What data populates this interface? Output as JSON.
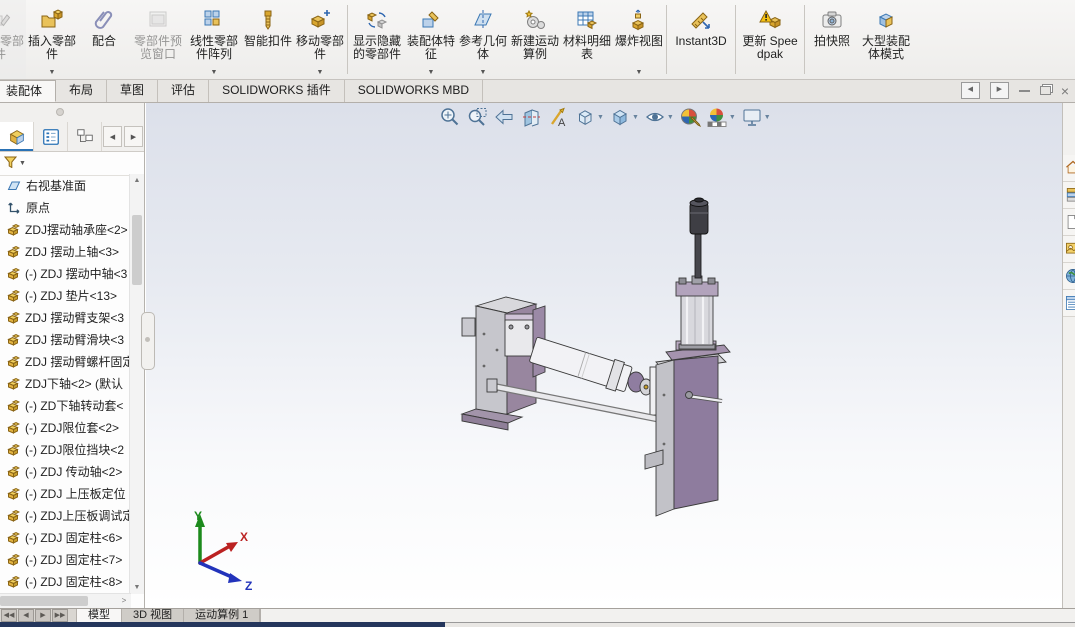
{
  "ribbon": {
    "items": [
      {
        "label": "编辑零部件",
        "icon": "edit-component",
        "disabled": true,
        "cut": true
      },
      {
        "label": "插入零部件",
        "icon": "insert-component",
        "dropdown": true
      },
      {
        "label": "配合",
        "icon": "mate"
      },
      {
        "label": "零部件预览窗口",
        "icon": "component-preview",
        "disabled": true
      },
      {
        "label": "线性零部件阵列",
        "icon": "linear-pattern",
        "dropdown": true
      },
      {
        "label": "智能扣件",
        "icon": "smart-fasteners"
      },
      {
        "label": "移动零部件",
        "icon": "move-component",
        "dropdown": true
      },
      {
        "sep": true
      },
      {
        "label": "显示隐藏的零部件",
        "icon": "show-hidden"
      },
      {
        "label": "装配体特征",
        "icon": "assembly-features",
        "dropdown": true
      },
      {
        "label": "参考几何体",
        "icon": "reference-geometry",
        "dropdown": true
      },
      {
        "label": "新建运动算例",
        "icon": "motion-study"
      },
      {
        "label": "材料明细表",
        "icon": "bom"
      },
      {
        "label": "爆炸视图",
        "icon": "exploded-view",
        "dropdown": true
      },
      {
        "sep": true
      },
      {
        "label": "Instant3D",
        "icon": "instant3d"
      },
      {
        "sep": true
      },
      {
        "label": "更新 Speedpak",
        "icon": "speedpak"
      },
      {
        "sep": true
      },
      {
        "label": "拍快照",
        "icon": "snapshot"
      },
      {
        "label": "大型装配体模式",
        "icon": "large-assembly"
      }
    ]
  },
  "tabs": {
    "active": 0,
    "items": [
      "装配体",
      "布局",
      "草图",
      "评估",
      "SOLIDWORKS 插件",
      "SOLIDWORKS MBD"
    ]
  },
  "window_controls": [
    "pane-left",
    "pane-right",
    "minimize",
    "restore",
    "close"
  ],
  "headsup": [
    {
      "name": "zoom-fit"
    },
    {
      "name": "zoom-area"
    },
    {
      "name": "previous-view"
    },
    {
      "name": "section-view"
    },
    {
      "name": "annotations"
    },
    {
      "name": "view-orientation",
      "dropdown": true
    },
    {
      "name": "display-style",
      "dropdown": true
    },
    {
      "name": "hide-show-items",
      "dropdown": true
    },
    {
      "name": "edit-appearance"
    },
    {
      "name": "apply-scene",
      "dropdown": true
    },
    {
      "name": "view-settings",
      "dropdown": true
    }
  ],
  "panel": {
    "tree": [
      {
        "icon": "plane",
        "label": "右视基准面"
      },
      {
        "icon": "origin",
        "label": "原点"
      },
      {
        "icon": "part",
        "label": "ZDJ摆动轴承座<2>"
      },
      {
        "icon": "part",
        "label": "ZDJ 摆动上轴<3>"
      },
      {
        "icon": "part",
        "label": "(-) ZDJ 摆动中轴<3"
      },
      {
        "icon": "part",
        "label": "(-) ZDJ 垫片<13>"
      },
      {
        "icon": "part",
        "label": "ZDJ 摆动臂支架<3"
      },
      {
        "icon": "part",
        "label": "ZDJ 摆动臂滑块<3"
      },
      {
        "icon": "part",
        "label": "ZDJ 摆动臂螺杆固定"
      },
      {
        "icon": "part",
        "label": "ZDJ下轴<2> (默认"
      },
      {
        "icon": "part",
        "label": "(-) ZD下轴转动套<"
      },
      {
        "icon": "part",
        "label": "(-) ZDJ限位套<2>"
      },
      {
        "icon": "part",
        "label": "(-) ZDJ限位挡块<2"
      },
      {
        "icon": "part",
        "label": "(-) ZDJ 传动轴<2>"
      },
      {
        "icon": "part",
        "label": "(-) ZDJ 上压板定位"
      },
      {
        "icon": "part",
        "label": "(-) ZDJ上压板调试定"
      },
      {
        "icon": "part",
        "label": "(-) ZDJ 固定柱<6>"
      },
      {
        "icon": "part",
        "label": "(-) ZDJ 固定柱<7>"
      },
      {
        "icon": "part",
        "label": "(-) ZDJ 固定柱<8>"
      }
    ]
  },
  "taskpane": [
    "home",
    "design-library",
    "file-explorer",
    "view-palette",
    "appearances",
    "custom-properties"
  ],
  "bottom": {
    "nav": [
      "first",
      "prev",
      "next",
      "last"
    ],
    "active": 0,
    "tabs": [
      "模型",
      "3D 视图",
      "运动算例 1"
    ]
  },
  "triad": {
    "x": "X",
    "y": "Y",
    "z": "Z"
  },
  "colors": {
    "accent_blue": "#2a72b5",
    "part_gold": "#e3b341",
    "bracket_purple": "#8e7c9e",
    "bg_top": "#dce0ea",
    "status_navy": "#24365c"
  }
}
